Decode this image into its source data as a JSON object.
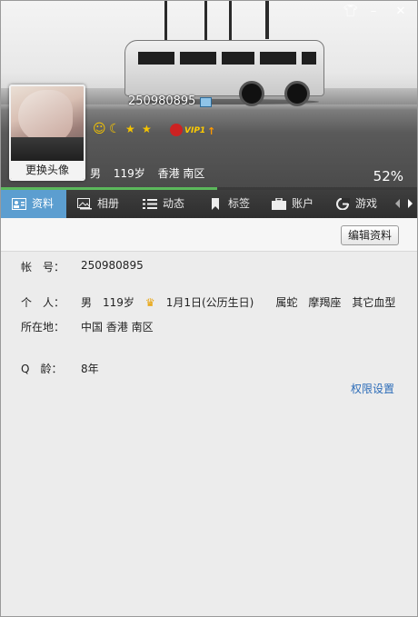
{
  "window": {
    "controls": [
      "skin-icon",
      "minimize-icon",
      "close-icon"
    ]
  },
  "header": {
    "qq_number": "250980895",
    "avatar_button": "更换头像",
    "vip_label": "VIP1",
    "gender": "男",
    "age": "119岁",
    "location": "香港 南区",
    "completeness_percent": "52%",
    "progress": 0.52,
    "level_icons": [
      "sun-icon",
      "moon-icon",
      "star-icon",
      "star-icon"
    ]
  },
  "tabs": [
    {
      "label": "资料",
      "icon": "profile-card-icon",
      "active": true
    },
    {
      "label": "相册",
      "icon": "album-icon",
      "active": false
    },
    {
      "label": "动态",
      "icon": "feed-icon",
      "active": false
    },
    {
      "label": "标签",
      "icon": "bookmark-icon",
      "active": false
    },
    {
      "label": "账户",
      "icon": "briefcase-icon",
      "active": false
    },
    {
      "label": "游戏",
      "icon": "game-icon",
      "active": false
    }
  ],
  "toolbar": {
    "edit_label": "编辑资料"
  },
  "profile": {
    "account_label": "帐　号：",
    "account_value": "250980895",
    "personal_label": "个　人：",
    "personal": {
      "gender": "男",
      "age": "119岁",
      "birthday": "1月1日(公历生日)",
      "zodiac": "属蛇",
      "constellation": "摩羯座",
      "blood": "其它血型"
    },
    "location_label": "所在地：",
    "location_value": "中国 香港 南区",
    "qage_label": "Q　龄：",
    "qage_value": "8年",
    "permission_link": "权限设置"
  },
  "colors": {
    "accent": "#5c9ed0",
    "progress": "#5bb85b",
    "link": "#2c6cb8"
  }
}
